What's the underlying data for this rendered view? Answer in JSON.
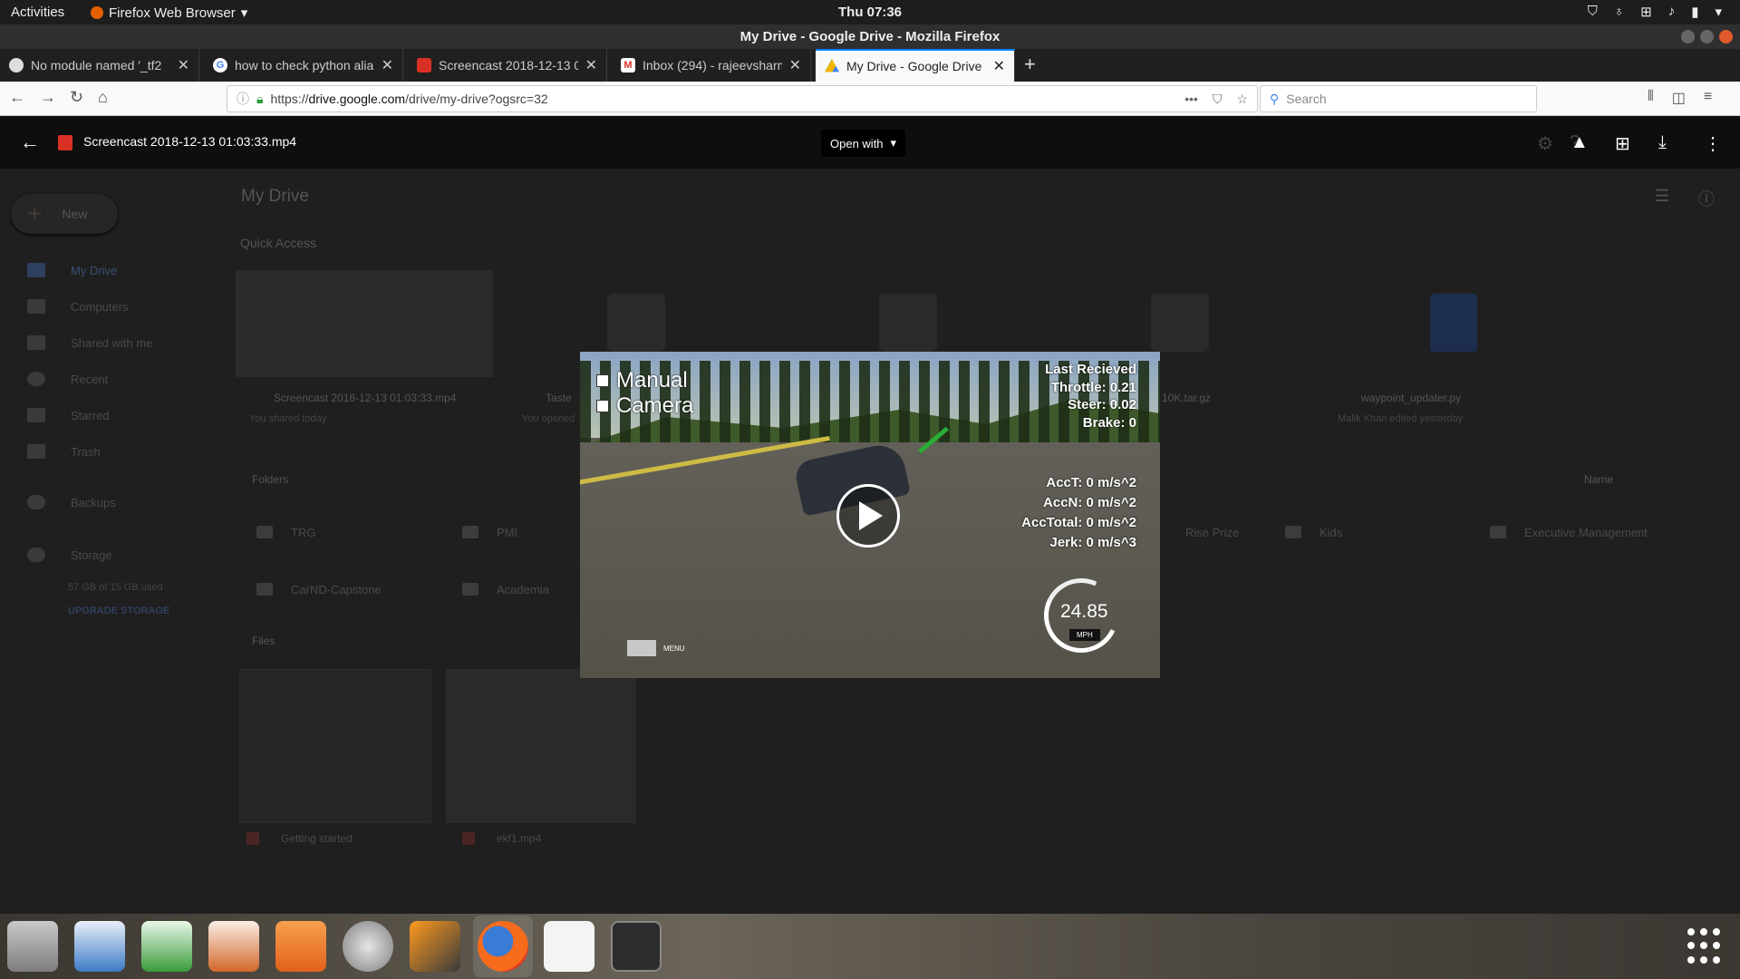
{
  "system": {
    "activities": "Activities",
    "app_name": "Firefox Web Browser",
    "clock": "Thu 07:36"
  },
  "window": {
    "title": "My Drive - Google Drive - Mozilla Firefox"
  },
  "tabs": [
    {
      "label": "No module named '_tf2",
      "favicon": "github-icon"
    },
    {
      "label": "how to check python alia",
      "favicon": "google-icon"
    },
    {
      "label": "Screencast 2018-12-13 0",
      "favicon": "video-file-icon"
    },
    {
      "label": "Inbox (294) - rajeevsharm",
      "favicon": "gmail-icon"
    },
    {
      "label": "My Drive - Google Drive",
      "favicon": "google-drive-icon",
      "active": true
    }
  ],
  "navbar": {
    "url_prefix": "https://",
    "url_host": "drive.google.com",
    "url_path": "/drive/my-drive?ogsrc=32",
    "search_placeholder": "Search"
  },
  "drive": {
    "title": "My Drive",
    "new_label": "New",
    "sidebar": [
      {
        "label": "My Drive"
      },
      {
        "label": "Computers"
      },
      {
        "label": "Shared with me"
      },
      {
        "label": "Recent"
      },
      {
        "label": "Starred"
      },
      {
        "label": "Trash"
      },
      {
        "label": "Backups"
      },
      {
        "label": "Storage"
      }
    ],
    "storage_used": "57 GB of 15 GB used",
    "upgrade": "UPGRADE STORAGE",
    "quick_access": "Quick Access",
    "quick_items": [
      {
        "name": "Screencast 2018-12-13 01:03:33.mp4",
        "sub": "You shared today"
      },
      {
        "name": "Taste",
        "sub": "You opened"
      },
      {
        "name": "10K.tar.gz",
        "sub": ""
      },
      {
        "name": "waypoint_updater.py",
        "sub": "Malik Khan edited yesterday"
      }
    ],
    "folders_label": "Folders",
    "sort_label": "Name",
    "folders": [
      "TRG",
      "PMI",
      "Rise Prize",
      "Kids",
      "Executive Management",
      "CarND-Capstone",
      "Academia"
    ],
    "files_label": "Files",
    "files": [
      "Getting started",
      "ekf1.mp4"
    ]
  },
  "preview": {
    "file_name": "Screencast 2018-12-13 01:03:33.mp4",
    "open_with": "Open with"
  },
  "video": {
    "manual": "Manual",
    "camera": "Camera",
    "last_received": "Last Recieved",
    "throttle": "Throttle: 0.21",
    "steer": "Steer: 0.02",
    "brake": "Brake: 0",
    "acct": "AccT: 0 m/s^2",
    "accn": "AccN: 0 m/s^2",
    "acctotal": "AccTotal: 0 m/s^2",
    "jerk": "Jerk: 0 m/s^3",
    "speed": "24.85",
    "unit": "MPH",
    "menu": "MENU"
  },
  "dock": [
    "files-icon",
    "writer-icon",
    "calc-icon",
    "impress-icon",
    "software-center-icon",
    "settings-tool-icon",
    "sublime-icon",
    "firefox-icon",
    "pdf-reader-icon",
    "terminal-icon"
  ]
}
